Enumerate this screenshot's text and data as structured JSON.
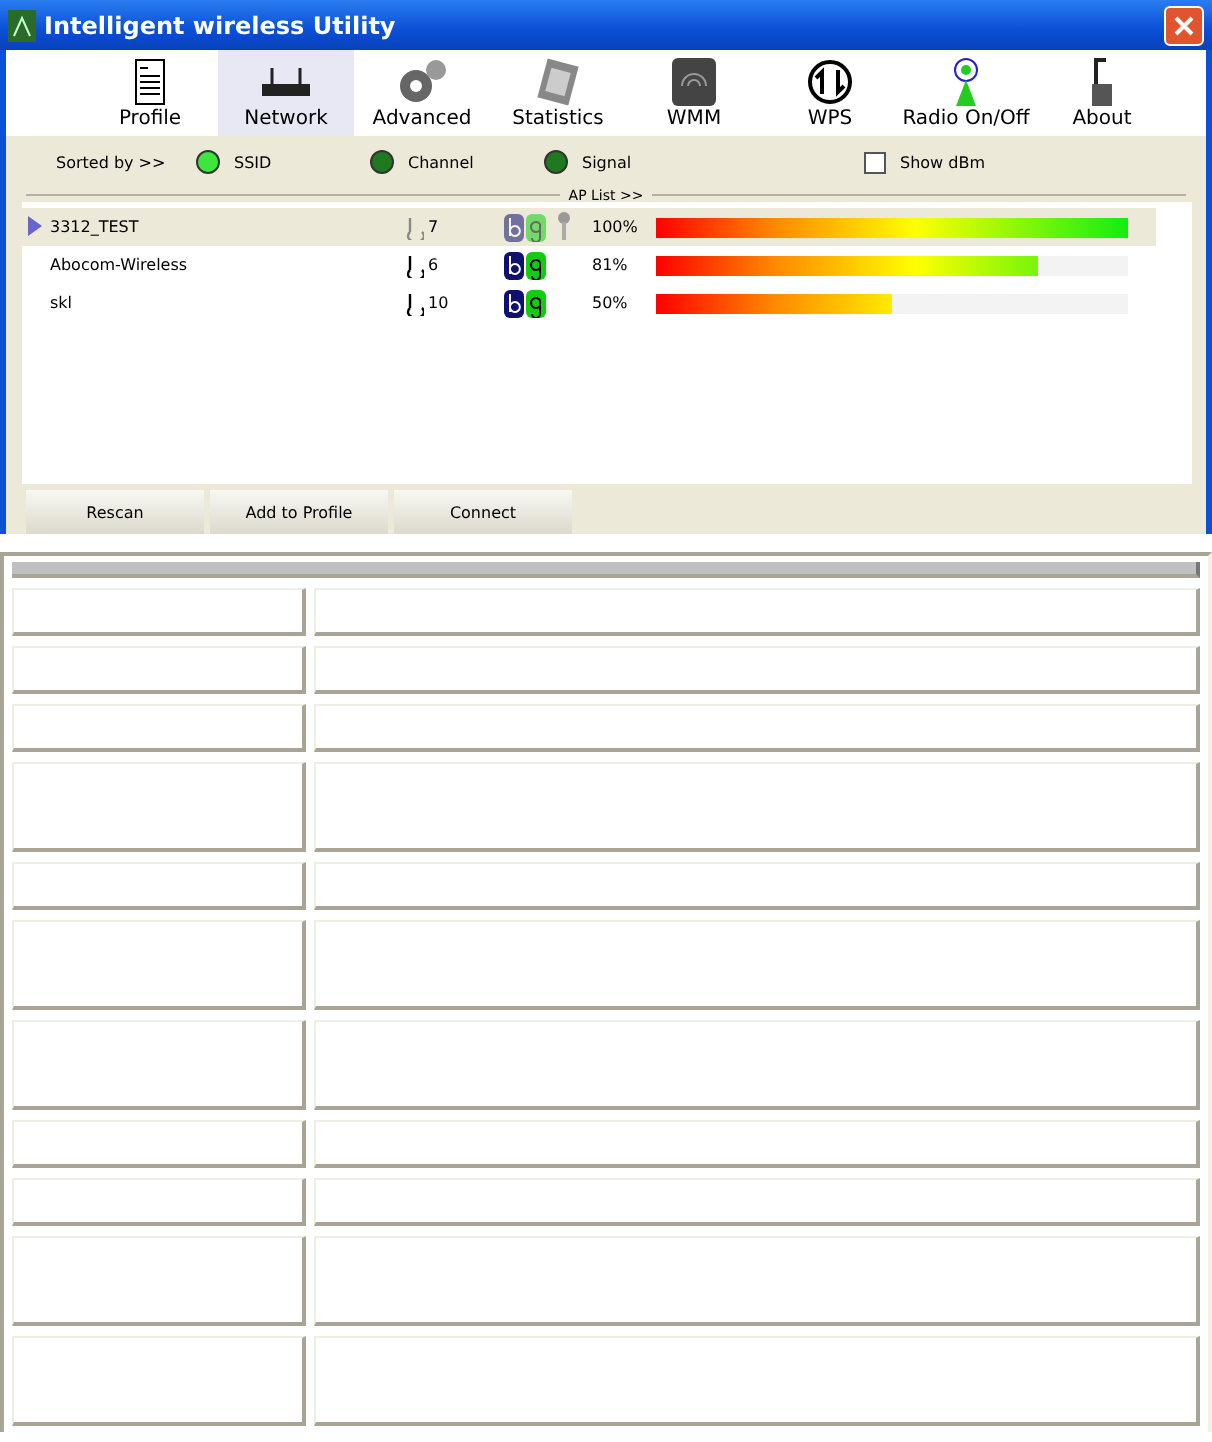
{
  "window": {
    "title": "Intelligent wireless Utility"
  },
  "toolbar": [
    {
      "label": "Profile",
      "kind": "profile",
      "selected": false
    },
    {
      "label": "Network",
      "kind": "network",
      "selected": true
    },
    {
      "label": "Advanced",
      "kind": "advanced",
      "selected": false
    },
    {
      "label": "Statistics",
      "kind": "statistics",
      "selected": false
    },
    {
      "label": "WMM",
      "kind": "wmm",
      "selected": false
    },
    {
      "label": "WPS",
      "kind": "wps",
      "selected": false
    },
    {
      "label": "Radio On/Off",
      "kind": "radio",
      "selected": false
    },
    {
      "label": "About",
      "kind": "about",
      "selected": false
    }
  ],
  "sort": {
    "label": "Sorted by >>",
    "options": [
      {
        "label": "SSID",
        "selected": true
      },
      {
        "label": "Channel",
        "selected": false
      },
      {
        "label": "Signal",
        "selected": false
      }
    ],
    "show_dbm": {
      "label": "Show dBm",
      "checked": false
    }
  },
  "ap_list": {
    "title": "AP List >>",
    "rows": [
      {
        "ssid": "3312_TEST",
        "channel": "7",
        "selected": true,
        "secured": true,
        "signal": "100%",
        "level": 1.0
      },
      {
        "ssid": "Abocom-Wireless",
        "channel": "6",
        "selected": false,
        "secured": false,
        "signal": "81%",
        "level": 0.81
      },
      {
        "ssid": "skl",
        "channel": "10",
        "selected": false,
        "secured": false,
        "signal": "50%",
        "level": 0.5
      }
    ]
  },
  "buttons": [
    "Rescan",
    "Add to Profile",
    "Connect"
  ],
  "table": {
    "rows": [
      {
        "kind": "single"
      },
      {
        "kind": "single"
      },
      {
        "kind": "single"
      },
      {
        "kind": "double"
      },
      {
        "kind": "single"
      },
      {
        "kind": "double"
      },
      {
        "kind": "double"
      },
      {
        "kind": "single"
      },
      {
        "kind": "single"
      },
      {
        "kind": "double"
      },
      {
        "kind": "double"
      }
    ]
  }
}
